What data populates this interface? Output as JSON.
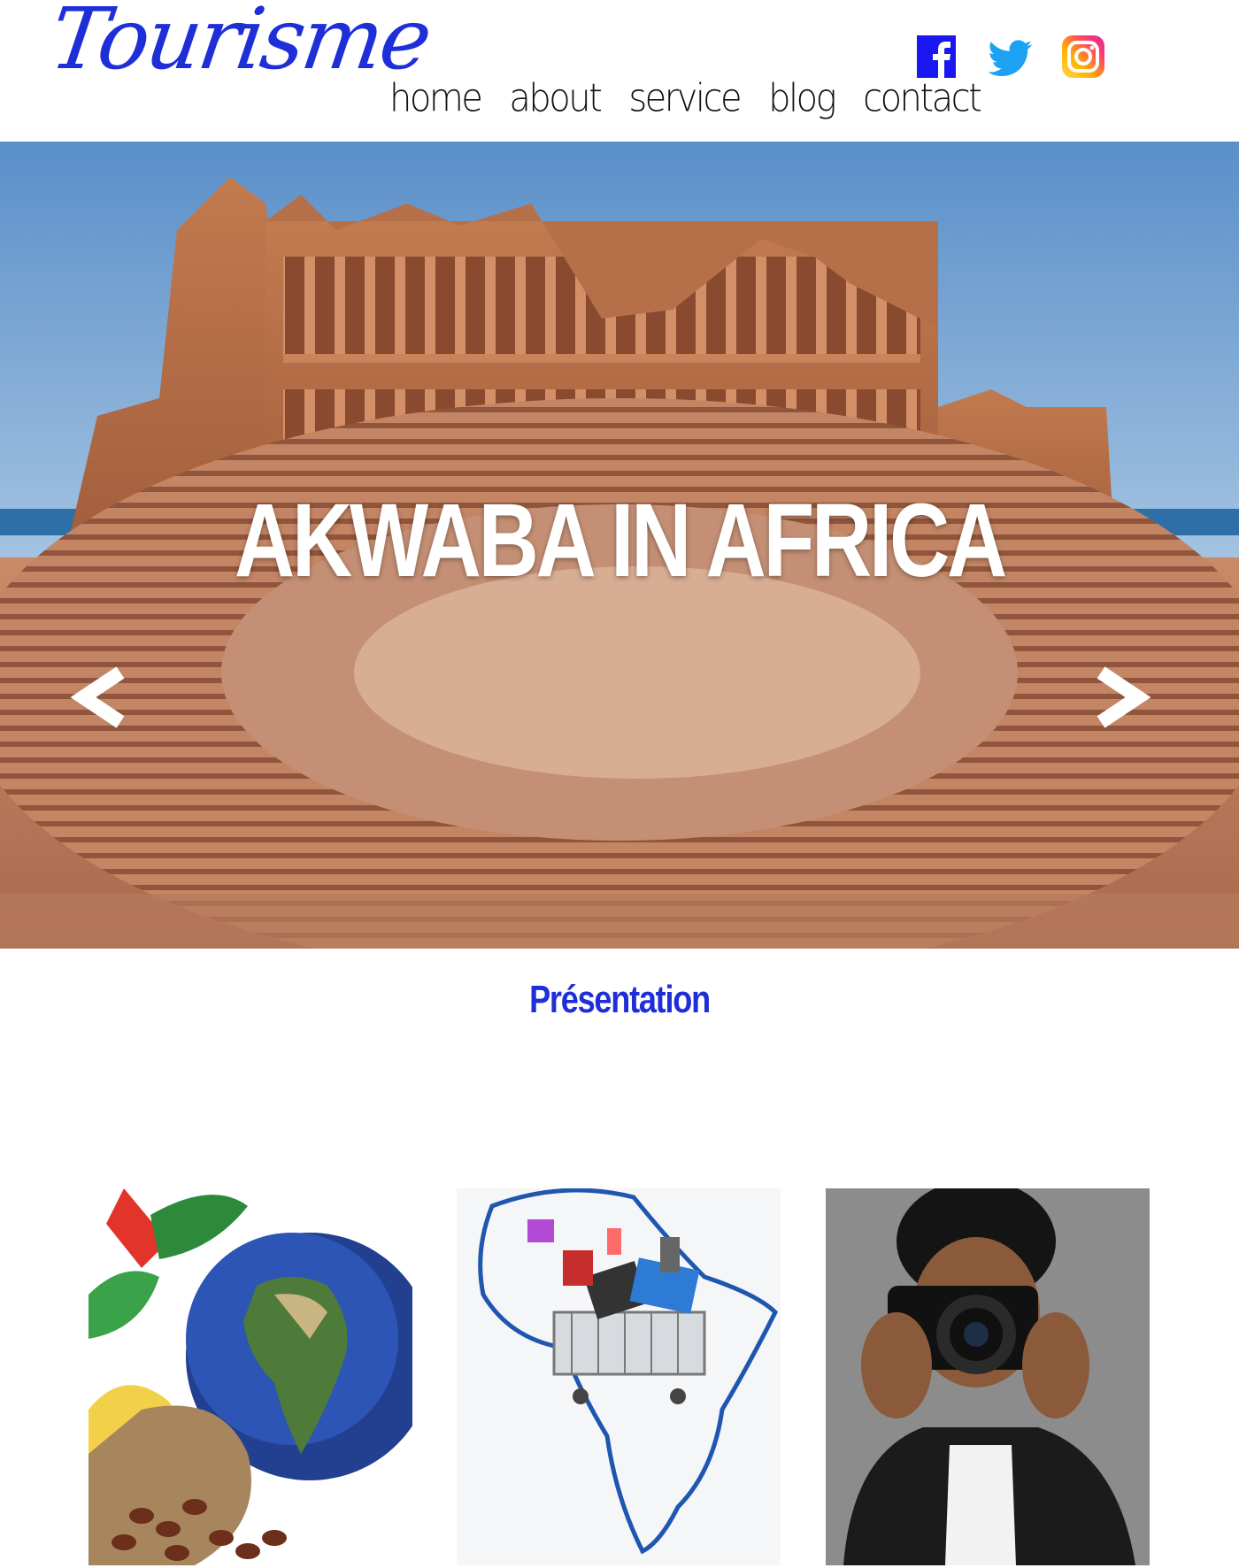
{
  "header": {
    "logo": "Tourisme",
    "nav": [
      "home",
      "about",
      "service",
      "blog",
      "contact"
    ],
    "social": [
      "facebook-icon",
      "twitter-icon",
      "instagram-icon"
    ]
  },
  "hero": {
    "title": "AKWABA IN AFRICA",
    "prev_icon": "chevron-left-icon",
    "next_icon": "chevron-right-icon"
  },
  "presentation": {
    "title": "Présentation"
  },
  "colors": {
    "brand": "#1f2fd8",
    "facebook": "#1a17f0",
    "twitter": "#1da1f2"
  }
}
